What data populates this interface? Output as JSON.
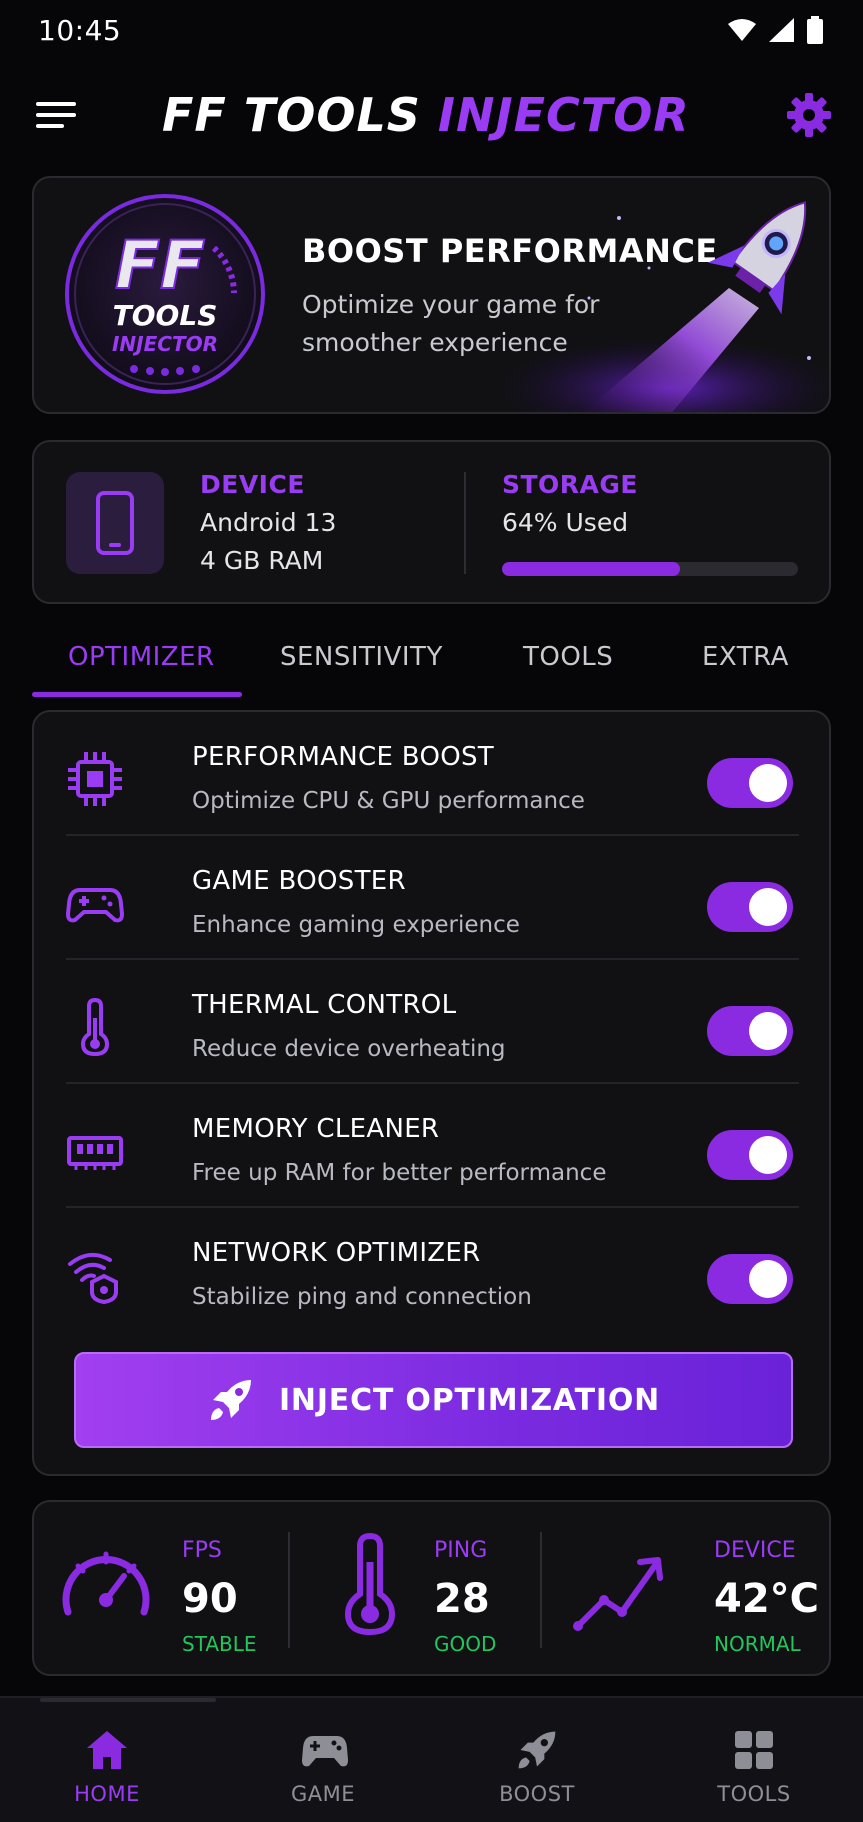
{
  "status_bar": {
    "time": "10:45",
    "icons": [
      "wifi-icon",
      "signal-icon",
      "battery-icon"
    ]
  },
  "header": {
    "title_part1": "FF TOOLS",
    "title_part2": "INJECTOR",
    "menu_icon": "menu-icon",
    "settings_icon": "gear-icon"
  },
  "hero": {
    "title": "BOOST PERFORMANCE",
    "subtitle": "Optimize your game for smoother experience",
    "logo_text": [
      "FF",
      "TOOLS",
      "INJECTOR"
    ]
  },
  "device_info": {
    "device_label": "DEVICE",
    "device_os": "Android 13",
    "device_ram": "4 GB RAM",
    "storage_label": "STORAGE",
    "storage_text": "64% Used",
    "storage_percent": 60
  },
  "tabs": [
    {
      "label": "OPTIMIZER",
      "active": true
    },
    {
      "label": "SENSITIVITY",
      "active": false
    },
    {
      "label": "TOOLS",
      "active": false
    },
    {
      "label": "EXTRA",
      "active": false
    }
  ],
  "optimizer": {
    "items": [
      {
        "icon": "cpu-icon",
        "title": "PERFORMANCE BOOST",
        "subtitle": "Optimize CPU & GPU performance",
        "enabled": true
      },
      {
        "icon": "gamepad-icon",
        "title": "GAME BOOSTER",
        "subtitle": "Enhance gaming experience",
        "enabled": true
      },
      {
        "icon": "thermometer-icon",
        "title": "THERMAL CONTROL",
        "subtitle": "Reduce device overheating",
        "enabled": true
      },
      {
        "icon": "memory-icon",
        "title": "MEMORY CLEANER",
        "subtitle": "Free up RAM for better performance",
        "enabled": true
      },
      {
        "icon": "network-icon",
        "title": "NETWORK OPTIMIZER",
        "subtitle": "Stabilize ping and connection",
        "enabled": true
      }
    ],
    "inject_button": "INJECT OPTIMIZATION"
  },
  "stats": [
    {
      "icon": "speedometer-icon",
      "label": "FPS",
      "value": "90",
      "status": "STABLE"
    },
    {
      "icon": "thermometer-icon",
      "label": "PING",
      "value": "28",
      "status": "GOOD"
    },
    {
      "icon": "trend-icon",
      "label": "DEVICE",
      "value": "42°C",
      "status": "NORMAL"
    }
  ],
  "bottom_nav": [
    {
      "icon": "home-icon",
      "label": "HOME",
      "active": true
    },
    {
      "icon": "gamepad-icon",
      "label": "GAME",
      "active": false
    },
    {
      "icon": "rocket-icon",
      "label": "BOOST",
      "active": false
    },
    {
      "icon": "grid-icon",
      "label": "TOOLS",
      "active": false
    }
  ],
  "colors": {
    "accent": "#8a2be2",
    "accent_light": "#9b3cf5",
    "good": "#22c55e",
    "background": "#060608",
    "card": "#111114"
  }
}
